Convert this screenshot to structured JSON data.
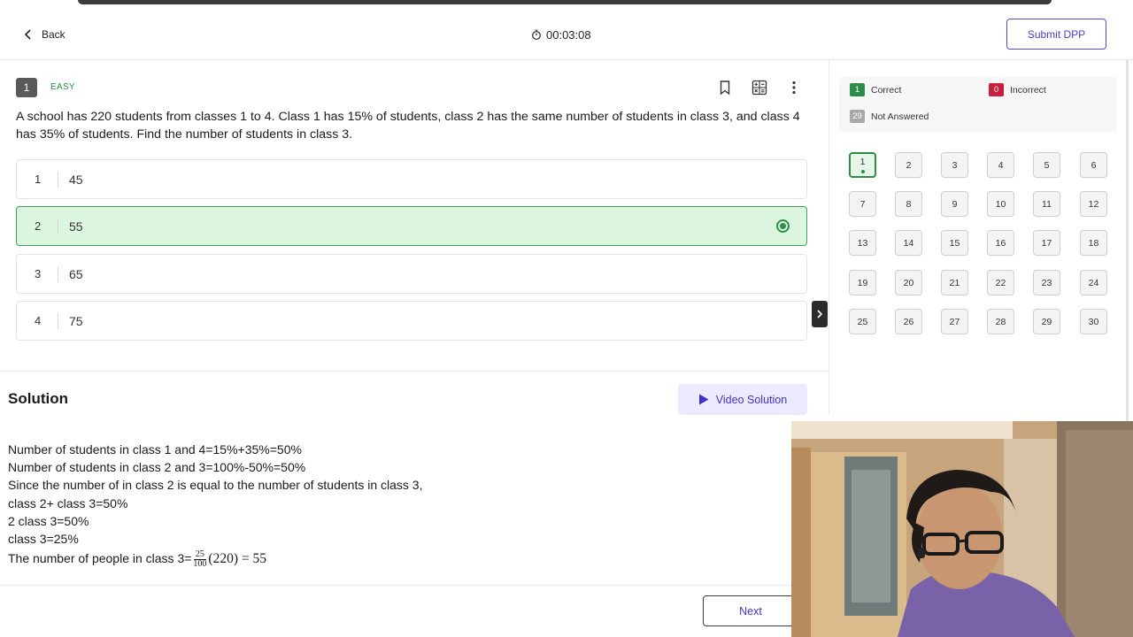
{
  "header": {
    "back_label": "Back",
    "timer": "00:03:08",
    "submit_label": "Submit DPP"
  },
  "question": {
    "number": "1",
    "difficulty": "EASY",
    "text": "A school has 220 students from classes 1 to 4. Class 1 has 15% of students, class 2 has the same number of students in class 3, and class 4 has 35% of students. Find the number of students in class 3.",
    "options": [
      {
        "num": "1",
        "value": "45",
        "selected": false
      },
      {
        "num": "2",
        "value": "55",
        "selected": true
      },
      {
        "num": "3",
        "value": "65",
        "selected": false
      },
      {
        "num": "4",
        "value": "75",
        "selected": false
      }
    ]
  },
  "solution": {
    "title": "Solution",
    "video_label": "Video Solution",
    "lines": [
      "Number of students in class 1 and 4=15%+35%=50%",
      "Number of students in class 2 and 3=100%-50%=50%",
      "Since the number of in class 2 is equal to the number of students in class 3,",
      "class 2+ class 3=50%",
      "2 class 3=50%",
      "class 3=25%"
    ],
    "last_line_prefix": "The number of people in class 3=",
    "fraction_num": "25",
    "fraction_den": "100",
    "last_line_suffix": "(220) = 55"
  },
  "footer": {
    "next_label": "Next"
  },
  "legend": {
    "correct_count": "1",
    "correct_label": "Correct",
    "incorrect_count": "0",
    "incorrect_label": "Incorrect",
    "unanswered_count": "29",
    "unanswered_label": "Not Answered"
  },
  "question_grid": {
    "current": "1",
    "numbers": [
      "1",
      "2",
      "3",
      "4",
      "5",
      "6",
      "7",
      "8",
      "9",
      "10",
      "11",
      "12",
      "13",
      "14",
      "15",
      "16",
      "17",
      "18",
      "19",
      "20",
      "21",
      "22",
      "23",
      "24",
      "25",
      "26",
      "27",
      "28",
      "29",
      "30"
    ]
  },
  "colors": {
    "accent": "#4b3ec7",
    "correct": "#2e8a47",
    "incorrect": "#c8203c",
    "unanswered": "#a8a8a8",
    "selected_bg": "#dcf5df"
  }
}
